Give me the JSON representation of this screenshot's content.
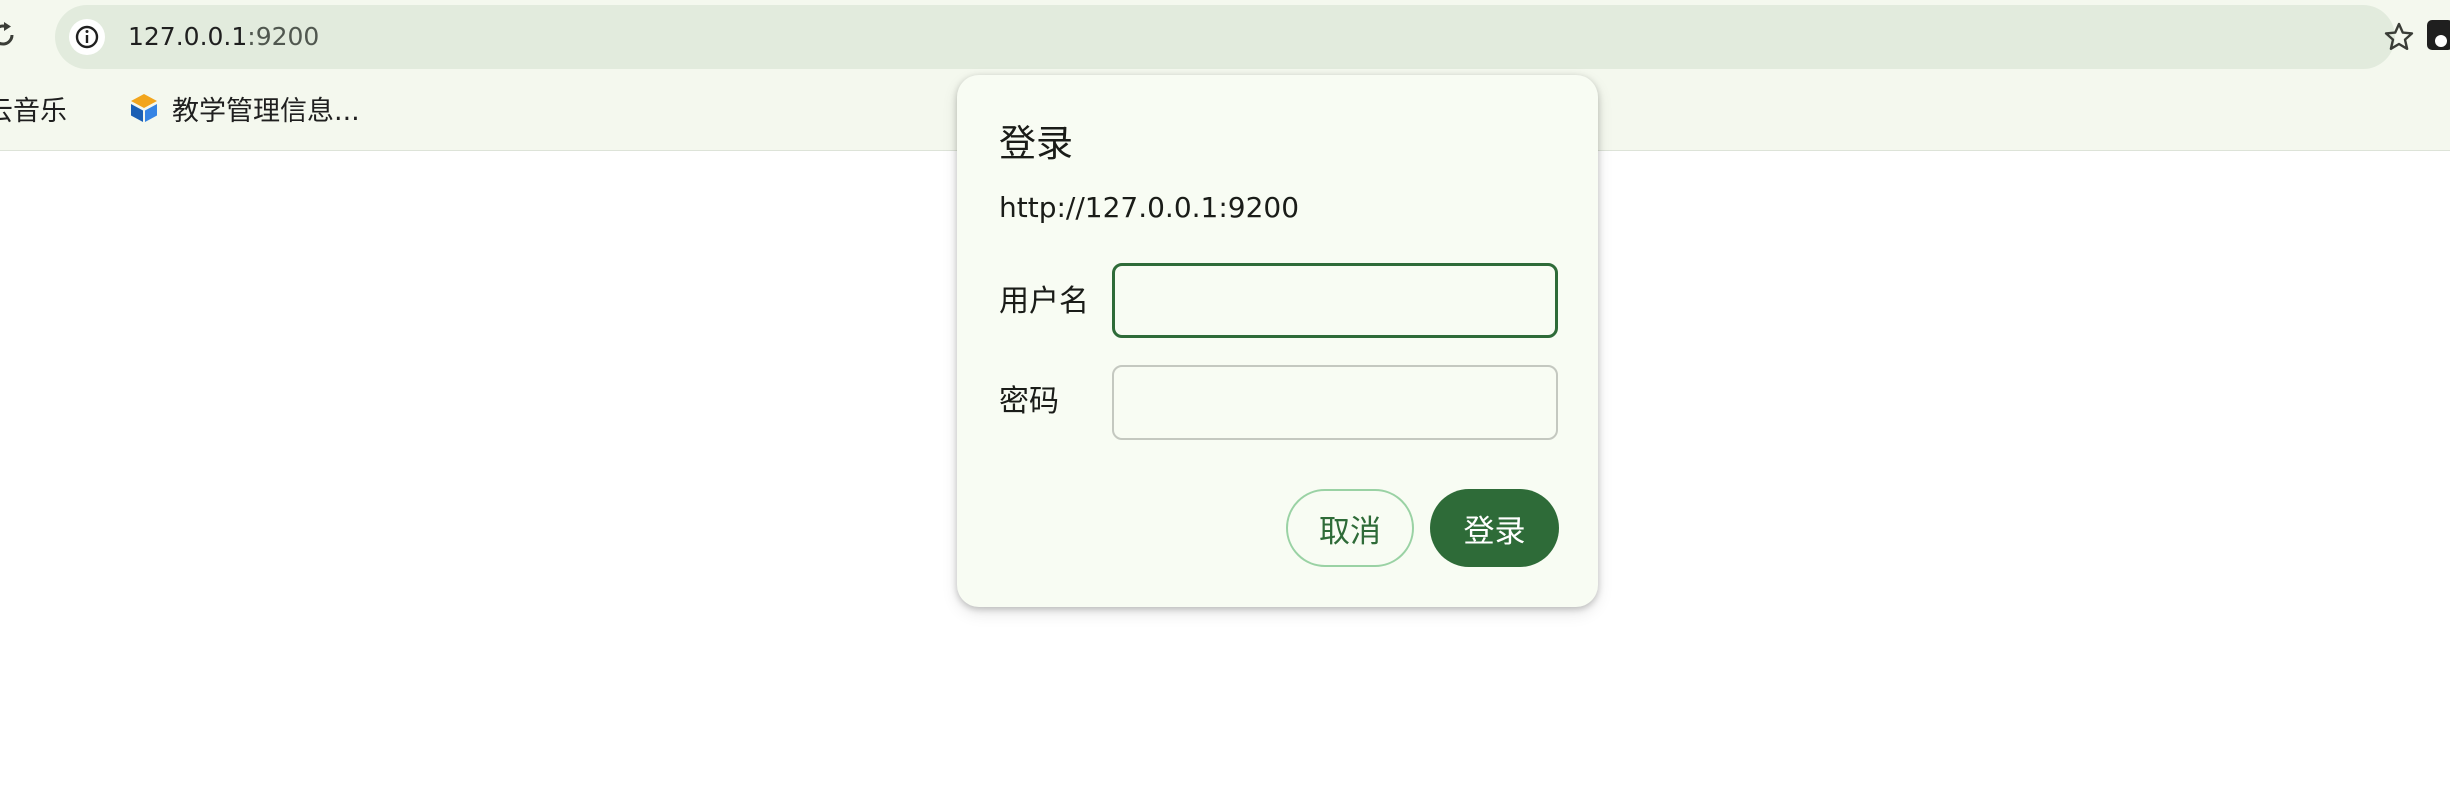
{
  "browser": {
    "url_host": "127.0.0.1",
    "url_port": ":9200",
    "bookmarks": [
      {
        "label": "云音乐"
      },
      {
        "label": "教学管理信息..."
      }
    ]
  },
  "dialog": {
    "title": "登录",
    "origin": "http://127.0.0.1:9200",
    "username_label": "用户名",
    "username_value": "",
    "password_label": "密码",
    "password_value": "",
    "cancel_label": "取消",
    "login_label": "登录"
  },
  "colors": {
    "accent": "#2e6b38",
    "toolbar_bg": "#f4f8ee",
    "omnibox_bg": "#e2ebdd",
    "dialog_bg": "#f8fcf3"
  },
  "icons": {
    "reload": "reload-icon",
    "site_info": "info-icon",
    "bookmark_star": "star-icon",
    "profile": "profile-icon",
    "bookmark_app": "app-icon"
  }
}
